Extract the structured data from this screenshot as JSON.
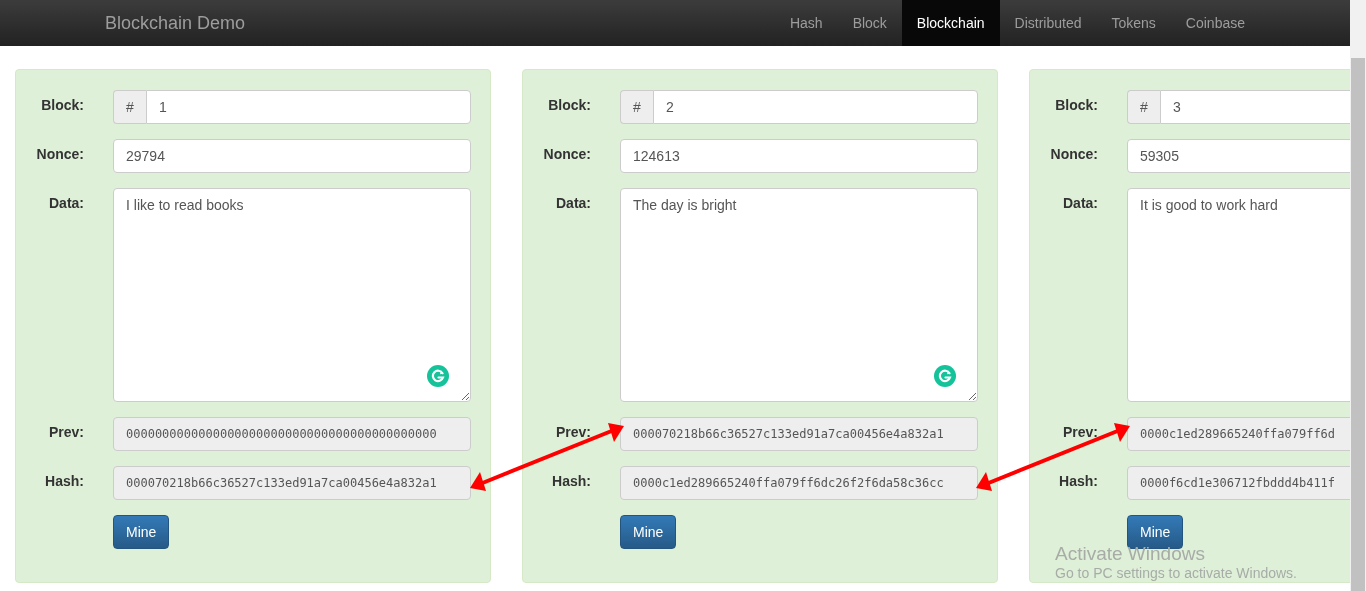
{
  "navbar": {
    "brand": "Blockchain Demo",
    "items": [
      {
        "label": "Hash",
        "selected": false
      },
      {
        "label": "Block",
        "selected": false
      },
      {
        "label": "Blockchain",
        "selected": true
      },
      {
        "label": "Distributed",
        "selected": false
      },
      {
        "label": "Tokens",
        "selected": false
      },
      {
        "label": "Coinbase",
        "selected": false
      }
    ]
  },
  "blocks": [
    {
      "block_label": "Block:",
      "prefix": "#",
      "number": "1",
      "nonce_label": "Nonce:",
      "nonce": "29794",
      "data_label": "Data:",
      "data": "I like to read books",
      "prev_label": "Prev:",
      "prev": "0000000000000000000000000000000000000000000",
      "hash_label": "Hash:",
      "hash": "000070218b66c36527c133ed91a7ca00456e4a832a1",
      "button": "Mine"
    },
    {
      "block_label": "Block:",
      "prefix": "#",
      "number": "2",
      "nonce_label": "Nonce:",
      "nonce": "124613",
      "data_label": "Data:",
      "data": "The day is bright",
      "prev_label": "Prev:",
      "prev": "000070218b66c36527c133ed91a7ca00456e4a832a1",
      "hash_label": "Hash:",
      "hash": "0000c1ed289665240ffa079ff6dc26f2f6da58c36cc",
      "button": "Mine"
    },
    {
      "block_label": "Block:",
      "prefix": "#",
      "number": "3",
      "nonce_label": "Nonce:",
      "nonce": "59305",
      "data_label": "Data:",
      "data": "It is good to work hard",
      "prev_label": "Prev:",
      "prev": "0000c1ed289665240ffa079ff6d",
      "hash_label": "Hash:",
      "hash": "0000f6cd1e306712fbddd4b411f",
      "button": "Mine"
    }
  ],
  "os_overlay": {
    "title": "Activate Windows",
    "subtitle": "Go to PC settings to activate Windows."
  }
}
